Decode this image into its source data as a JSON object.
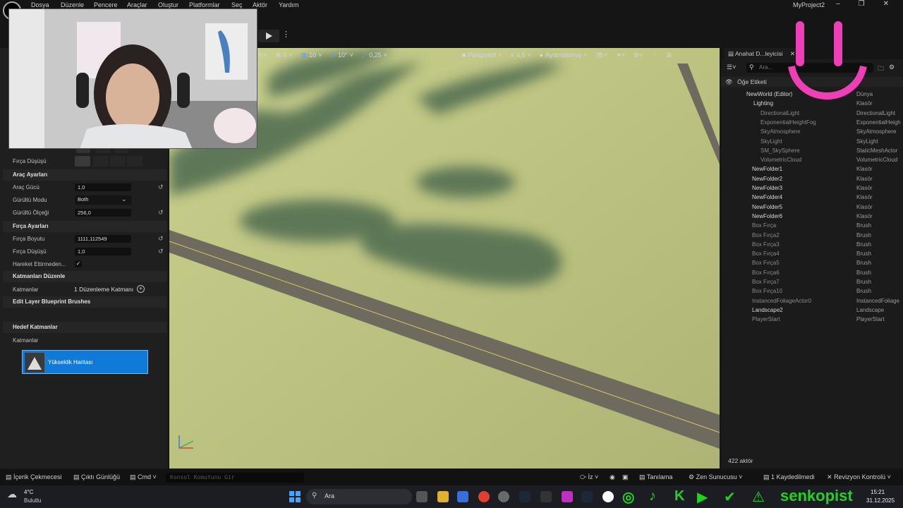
{
  "menu": [
    "Dosya",
    "Düzenle",
    "Pencere",
    "Araçlar",
    "Oluştur",
    "Platformlar",
    "Seç",
    "Aktör",
    "Yardım"
  ],
  "project_title": "MyProject2",
  "viewport_toolbar": {
    "snap_rot": "0",
    "grid": "10",
    "rot": "10°",
    "scale": "0,25",
    "perspective": "Perspektif",
    "speed": "4,8",
    "lit": "Aydınlatılmış"
  },
  "left_panel": {
    "brush_falloff_label": "Fırça Düşüşü",
    "tool_settings_title": "Araç Ayarları",
    "tool_strength_label": "Araç Gücü",
    "tool_strength_value": "1,0",
    "noise_mode_label": "Gürültü Modu",
    "noise_mode_value": "Both",
    "noise_scale_label": "Gürültü Ölçeği",
    "noise_scale_value": "256,0",
    "brush_settings_title": "Fırça Ayarları",
    "brush_size_label": "Fırça Boyutu",
    "brush_size_value": "1111,112549",
    "brush_falloff2_label": "Fırça Düşüşü",
    "brush_falloff2_value": "1,0",
    "move_label": "Hareket Ettirmeden...",
    "layers_edit_title": "Katmanları Düzenle",
    "layers_label": "Katmanlar",
    "layers_value": "1 Düzenleme Katmanı",
    "edit_blueprint_title": "Edit Layer Blueprint Brushes",
    "target_layers_title": "Hedef Katmanlar",
    "target_layers_label": "Katmanlar",
    "heightmap_label": "Yükseklik Haritası"
  },
  "outliner": {
    "tab_title": "Anahat D...leyicisi",
    "search_placeholder": "Ara...",
    "column_label": "Öğe Etiketi",
    "actor_count": "422 aktör",
    "rows": [
      {
        "name": "NewWorld (Editor)",
        "type": "Dünya"
      },
      {
        "name": "Lighting",
        "type": "Klasör"
      },
      {
        "name": "DirectionalLight",
        "type": "DirectionalLight"
      },
      {
        "name": "ExponentialHeightFog",
        "type": "ExponentialHeigh"
      },
      {
        "name": "SkyAtmosphere",
        "type": "SkyAtmosphere"
      },
      {
        "name": "SkyLight",
        "type": "SkyLight"
      },
      {
        "name": "SM_SkySphere",
        "type": "StaticMeshActor"
      },
      {
        "name": "VolumetricCloud",
        "type": "VolumetricCloud"
      },
      {
        "name": "NewFolder1",
        "type": "Klasör"
      },
      {
        "name": "NewFolder2",
        "type": "Klasör"
      },
      {
        "name": "NewFolder3",
        "type": "Klasör"
      },
      {
        "name": "NewFolder4",
        "type": "Klasör"
      },
      {
        "name": "NewFolder5",
        "type": "Klasör"
      },
      {
        "name": "NewFolder6",
        "type": "Klasör"
      },
      {
        "name": "Box Fırça",
        "type": "Brush"
      },
      {
        "name": "Box Fırça2",
        "type": "Brush"
      },
      {
        "name": "Box Fırça3",
        "type": "Brush"
      },
      {
        "name": "Box Fırça4",
        "type": "Brush"
      },
      {
        "name": "Box Fırça5",
        "type": "Brush"
      },
      {
        "name": "Box Fırça6",
        "type": "Brush"
      },
      {
        "name": "Box Fırça7",
        "type": "Brush"
      },
      {
        "name": "Box Fırça10",
        "type": "Brush"
      },
      {
        "name": "InstancedFoliageActor0",
        "type": "InstancedFoliage"
      },
      {
        "name": "Landscape2",
        "type": "Landscape"
      },
      {
        "name": "PlayerStart",
        "type": "PlayerStart"
      }
    ]
  },
  "statusbar": {
    "content_drawer": "İçerik Çekmecesi",
    "output_log": "Çıktı Günlüğü",
    "cmd": "Cmd",
    "console_placeholder": "Konsol Komutunu Gir",
    "trace": "İz",
    "derive": "Tanılama",
    "zen": "Zen Sunucusu",
    "saved": "1 Kaydedilmedi",
    "revision": "Revizyon Kontrolü"
  },
  "taskbar": {
    "temp": "4°C",
    "weather": "Bulutlu",
    "search": "Ara",
    "time": "15:21",
    "date": "31.12.2025",
    "overlay_name": "senkopist"
  }
}
